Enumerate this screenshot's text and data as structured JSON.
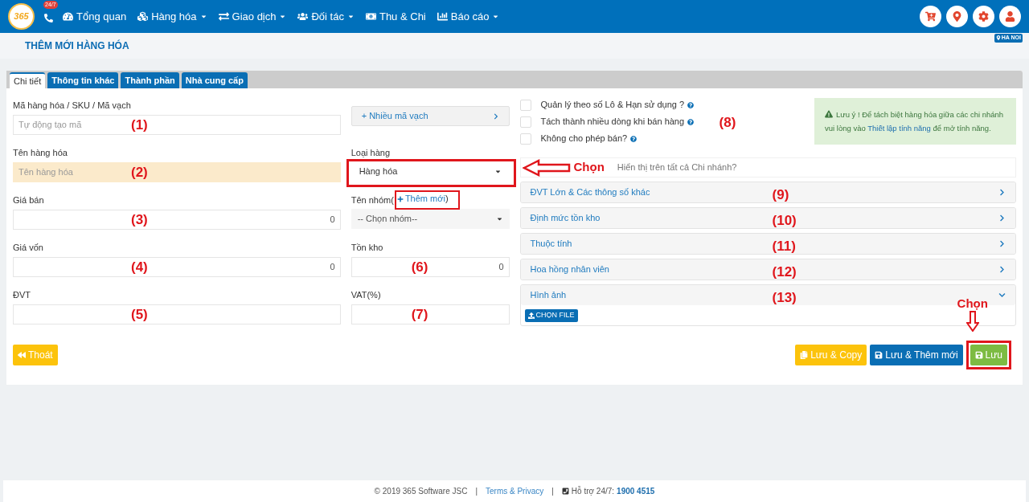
{
  "header": {
    "logo": "365",
    "badge": "24/7",
    "nav": [
      {
        "kind": "gauge",
        "label": "Tổng quan",
        "dropdown": false
      },
      {
        "kind": "cubes",
        "label": "Hàng hóa",
        "dropdown": true
      },
      {
        "kind": "exchange",
        "label": "Giao dịch",
        "dropdown": true
      },
      {
        "kind": "users",
        "label": "Đối tác",
        "dropdown": true
      },
      {
        "kind": "money",
        "label": "Thu & Chi",
        "dropdown": false
      },
      {
        "kind": "chart",
        "label": "Báo cáo",
        "dropdown": true
      }
    ],
    "actions": [
      {
        "kind": "cart"
      },
      {
        "kind": "pin"
      },
      {
        "kind": "gear"
      },
      {
        "kind": "user"
      }
    ],
    "branch": "HA NOI"
  },
  "page_title": "THÊM MỚI HÀNG HÓA",
  "tabs": [
    {
      "label": "Chi tiết",
      "selected": true
    },
    {
      "label": "Thông tin khác",
      "selected": false
    },
    {
      "label": "Thành phần",
      "selected": false
    },
    {
      "label": "Nhà cung cấp",
      "selected": false
    }
  ],
  "left_fields": [
    {
      "label": "Mã hàng hóa / SKU / Mã vạch",
      "placeholder": "Tự động tạo mã",
      "annotation": "(1)",
      "highlighted": false
    },
    {
      "label": "Tên hàng hóa",
      "placeholder": "Tên hàng hóa",
      "annotation": "(2)",
      "highlighted": true
    },
    {
      "label": "Giá bán",
      "value": "0",
      "annotation": "(3)",
      "highlighted": false
    },
    {
      "label": "Giá vốn",
      "value": "0",
      "annotation": "(4)",
      "highlighted": false
    },
    {
      "label": "ĐVT",
      "annotation": "(5)",
      "highlighted": false
    }
  ],
  "barcode_button": "+ Nhiều mã vạch",
  "item_type": {
    "label": "Loại hàng",
    "value": "Hàng hóa",
    "marked": true,
    "callout": "Chọn"
  },
  "group": {
    "label": "Tên nhóm(",
    "link": "Thêm mới",
    "suffix": ")",
    "link_marked": true,
    "placeholder": "-- Chọn nhóm--"
  },
  "stock": {
    "label": "Tồn kho",
    "value": "0",
    "annotation": "(6)"
  },
  "vat": {
    "label": "VAT(%)",
    "annotation": "(7)"
  },
  "options": [
    {
      "label": "Quản lý theo số Lô & Hạn sử dụng ?",
      "checked": false
    },
    {
      "label": "Tách thành nhiều dòng khi bán hàng",
      "checked": false
    },
    {
      "label": "Không cho phép bán?",
      "checked": false
    }
  ],
  "options_annotation": "(8)",
  "note": {
    "before": "Lưu ý ! Để tách biệt hàng hóa giữa các chi nhánh vui lòng vào",
    "link": "Thiết lập tính năng",
    "after": "để mở tính năng."
  },
  "branch_option": "Hiển thị trên tất cả Chi nhánh?",
  "sections": [
    {
      "title": "ĐVT Lớn & Các thông số khác",
      "annotation": "(9)",
      "expanded": false
    },
    {
      "title": "Định mức tồn kho",
      "annotation": "(10)",
      "expanded": false
    },
    {
      "title": "Thuộc tính",
      "annotation": "(11)",
      "expanded": false
    },
    {
      "title": "Hoa hồng nhân viên",
      "annotation": "(12)",
      "expanded": false
    },
    {
      "title": "Hình ảnh",
      "annotation": "(13)",
      "expanded": true,
      "button": "CHỌN FILE"
    }
  ],
  "buttons": [
    {
      "kind": "exit",
      "label": "Thoát",
      "marked": false
    },
    {
      "kind": "copy",
      "label": "Lưu & Copy",
      "marked": false
    },
    {
      "kind": "save_new",
      "label": "Lưu & Thêm mới",
      "marked": false
    },
    {
      "kind": "save",
      "label": "Lưu",
      "marked": true,
      "callout": "Chọn"
    }
  ],
  "footer": {
    "copyright": "© 2019 365 Software JSC",
    "sep1": "|",
    "terms": "Terms & Privacy",
    "sep2": "|",
    "support": "Hỗ trợ 24/7:",
    "phone": "1900 4515"
  }
}
